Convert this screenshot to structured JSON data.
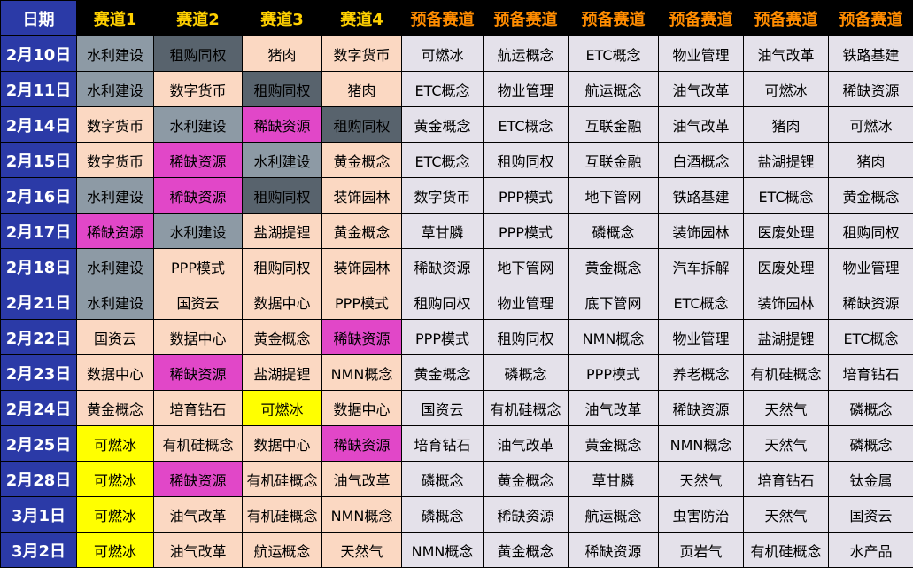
{
  "header": {
    "date": "日期",
    "tracks": [
      "赛道1",
      "赛道2",
      "赛道3",
      "赛道4"
    ],
    "reserves": [
      "预备赛道",
      "预备赛道",
      "预备赛道",
      "预备赛道",
      "预备赛道",
      "预备赛道"
    ]
  },
  "highlight_colors": {
    "gray": "#8d9aa5",
    "slate": "#58636d",
    "magenta": "#e147c8",
    "yellow": "#ffff00",
    "peach": "#fbd8c2",
    "reserve": "#e4e1ea",
    "date_bg": "#2b3aa7",
    "header_track": "#ffd000",
    "header_reserve": "#ff8c00"
  },
  "rows": [
    {
      "date": "2月10日",
      "tracks": [
        {
          "text": "水利建设",
          "hl": "gray"
        },
        {
          "text": "租购同权",
          "hl": "slate"
        },
        {
          "text": "猪肉",
          "hl": ""
        },
        {
          "text": "数字货币",
          "hl": ""
        }
      ],
      "reserves": [
        "可燃冰",
        "航运概念",
        "ETC概念",
        "物业管理",
        "油气改革",
        "铁路基建"
      ]
    },
    {
      "date": "2月11日",
      "tracks": [
        {
          "text": "水利建设",
          "hl": "gray"
        },
        {
          "text": "数字货币",
          "hl": ""
        },
        {
          "text": "租购同权",
          "hl": "slate"
        },
        {
          "text": "猪肉",
          "hl": ""
        }
      ],
      "reserves": [
        "ETC概念",
        "物业管理",
        "航运概念",
        "油气改革",
        "可燃冰",
        "稀缺资源"
      ]
    },
    {
      "date": "2月14日",
      "tracks": [
        {
          "text": "数字货币",
          "hl": ""
        },
        {
          "text": "水利建设",
          "hl": "gray"
        },
        {
          "text": "稀缺资源",
          "hl": "magenta"
        },
        {
          "text": "租购同权",
          "hl": "slate"
        }
      ],
      "reserves": [
        "黄金概念",
        "ETC概念",
        "互联金融",
        "油气改革",
        "猪肉",
        "可燃冰"
      ]
    },
    {
      "date": "2月15日",
      "tracks": [
        {
          "text": "数字货币",
          "hl": ""
        },
        {
          "text": "稀缺资源",
          "hl": "magenta"
        },
        {
          "text": "水利建设",
          "hl": "gray"
        },
        {
          "text": "黄金概念",
          "hl": ""
        }
      ],
      "reserves": [
        "ETC概念",
        "租购同权",
        "互联金融",
        "白酒概念",
        "盐湖提锂",
        "猪肉"
      ]
    },
    {
      "date": "2月16日",
      "tracks": [
        {
          "text": "水利建设",
          "hl": "gray"
        },
        {
          "text": "稀缺资源",
          "hl": "magenta"
        },
        {
          "text": "租购同权",
          "hl": "slate"
        },
        {
          "text": "装饰园林",
          "hl": ""
        }
      ],
      "reserves": [
        "数字货币",
        "PPP模式",
        "地下管网",
        "铁路基建",
        "ETC概念",
        "黄金概念"
      ]
    },
    {
      "date": "2月17日",
      "tracks": [
        {
          "text": "稀缺资源",
          "hl": "magenta"
        },
        {
          "text": "水利建设",
          "hl": "gray"
        },
        {
          "text": "盐湖提锂",
          "hl": ""
        },
        {
          "text": "黄金概念",
          "hl": ""
        }
      ],
      "reserves": [
        "草甘膦",
        "PPP模式",
        "磷概念",
        "装饰园林",
        "医废处理",
        "租购同权"
      ]
    },
    {
      "date": "2月18日",
      "tracks": [
        {
          "text": "水利建设",
          "hl": "gray"
        },
        {
          "text": "PPP模式",
          "hl": ""
        },
        {
          "text": "租购同权",
          "hl": ""
        },
        {
          "text": "装饰园林",
          "hl": ""
        }
      ],
      "reserves": [
        "稀缺资源",
        "地下管网",
        "黄金概念",
        "汽车拆解",
        "医废处理",
        "物业管理"
      ]
    },
    {
      "date": "2月21日",
      "tracks": [
        {
          "text": "水利建设",
          "hl": "gray"
        },
        {
          "text": "国资云",
          "hl": ""
        },
        {
          "text": "数据中心",
          "hl": ""
        },
        {
          "text": "PPP模式",
          "hl": ""
        }
      ],
      "reserves": [
        "租购同权",
        "物业管理",
        "底下管网",
        "ETC概念",
        "装饰园林",
        "稀缺资源"
      ]
    },
    {
      "date": "2月22日",
      "tracks": [
        {
          "text": "国资云",
          "hl": ""
        },
        {
          "text": "数据中心",
          "hl": ""
        },
        {
          "text": "黄金概念",
          "hl": ""
        },
        {
          "text": "稀缺资源",
          "hl": "magenta"
        }
      ],
      "reserves": [
        "PPP模式",
        "租购同权",
        "NMN概念",
        "物业管理",
        "盐湖提锂",
        "ETC概念"
      ]
    },
    {
      "date": "2月23日",
      "tracks": [
        {
          "text": "数据中心",
          "hl": ""
        },
        {
          "text": "稀缺资源",
          "hl": "magenta"
        },
        {
          "text": "盐湖提锂",
          "hl": ""
        },
        {
          "text": "NMN概念",
          "hl": ""
        }
      ],
      "reserves": [
        "黄金概念",
        "磷概念",
        "PPP模式",
        "养老概念",
        "有机硅概念",
        "培育钻石"
      ]
    },
    {
      "date": "2月24日",
      "tracks": [
        {
          "text": "黄金概念",
          "hl": ""
        },
        {
          "text": "培育钻石",
          "hl": ""
        },
        {
          "text": "可燃冰",
          "hl": "yellow"
        },
        {
          "text": "数据中心",
          "hl": ""
        }
      ],
      "reserves": [
        "国资云",
        "有机硅概念",
        "油气改革",
        "稀缺资源",
        "天然气",
        "磷概念"
      ]
    },
    {
      "date": "2月25日",
      "tracks": [
        {
          "text": "可燃冰",
          "hl": "yellow"
        },
        {
          "text": "有机硅概念",
          "hl": ""
        },
        {
          "text": "数据中心",
          "hl": ""
        },
        {
          "text": "稀缺资源",
          "hl": "magenta"
        }
      ],
      "reserves": [
        "培育钻石",
        "油气改革",
        "黄金概念",
        "NMN概念",
        "天然气",
        "磷概念"
      ]
    },
    {
      "date": "2月28日",
      "tracks": [
        {
          "text": "可燃冰",
          "hl": "yellow"
        },
        {
          "text": "稀缺资源",
          "hl": "magenta"
        },
        {
          "text": "有机硅概念",
          "hl": ""
        },
        {
          "text": "油气改革",
          "hl": ""
        }
      ],
      "reserves": [
        "磷概念",
        "黄金概念",
        "草甘膦",
        "天然气",
        "培育钻石",
        "钛金属"
      ]
    },
    {
      "date": "3月1日",
      "tracks": [
        {
          "text": "可燃冰",
          "hl": "yellow"
        },
        {
          "text": "油气改革",
          "hl": ""
        },
        {
          "text": "有机硅概念",
          "hl": ""
        },
        {
          "text": "NMN概念",
          "hl": ""
        }
      ],
      "reserves": [
        "磷概念",
        "稀缺资源",
        "航运概念",
        "虫害防治",
        "天然气",
        "国资云"
      ]
    },
    {
      "date": "3月2日",
      "tracks": [
        {
          "text": "可燃冰",
          "hl": "yellow"
        },
        {
          "text": "油气改革",
          "hl": ""
        },
        {
          "text": "航运概念",
          "hl": ""
        },
        {
          "text": "天然气",
          "hl": ""
        }
      ],
      "reserves": [
        "NMN概念",
        "黄金概念",
        "稀缺资源",
        "页岩气",
        "有机硅概念",
        "水产品"
      ]
    }
  ]
}
